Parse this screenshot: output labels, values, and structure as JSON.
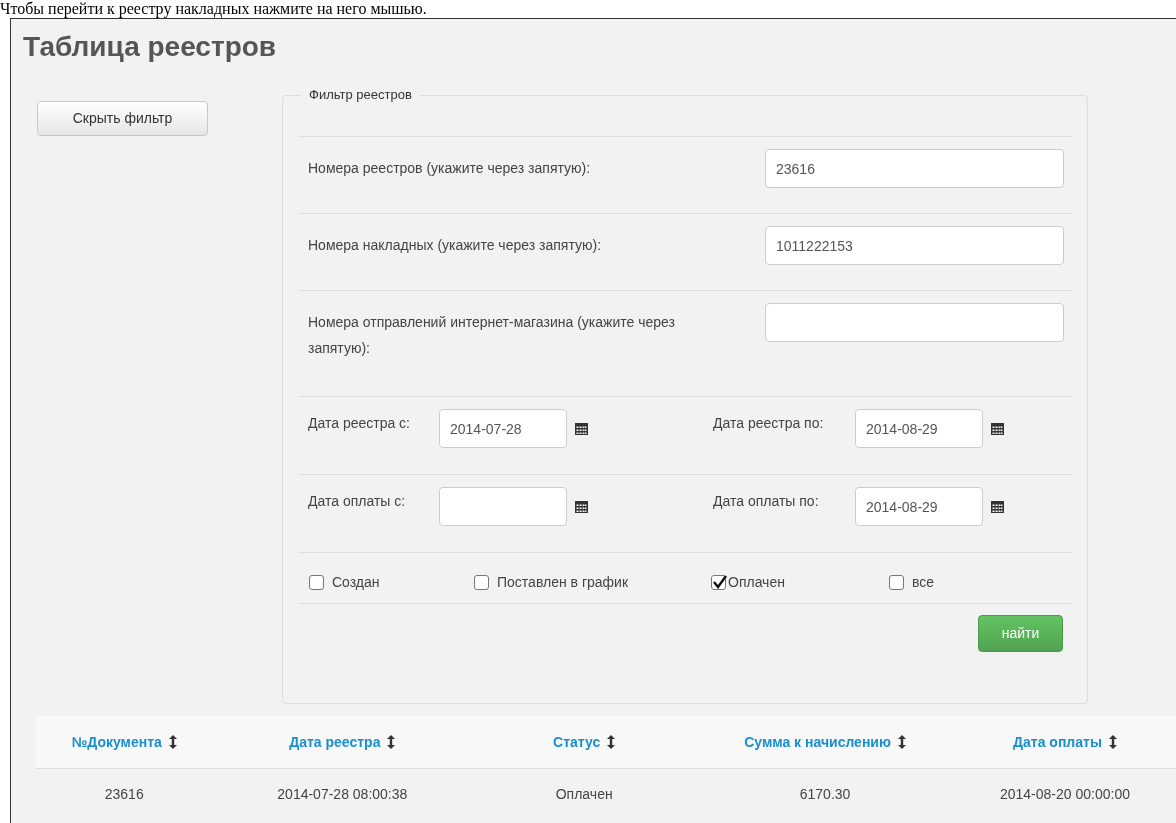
{
  "instruction": "Чтобы перейти к реестру накладных нажмите на него мышью.",
  "title": "Таблица реестров",
  "toggle_filter_button": "Скрыть фильтр",
  "filter": {
    "legend": "Фильтр реестров",
    "text_fields": [
      {
        "label": "Номера реестров (укажите через запятую):",
        "value": "23616"
      },
      {
        "label": "Номера накладных (укажите через запятую):",
        "value": "1011222153"
      },
      {
        "label": "Номера отправлений интернет-магазина (укажите через запятую):"
      }
    ],
    "date_rows": [
      [
        {
          "label": "Дата реестра с:",
          "value": "2014-07-28"
        },
        {
          "label": "Дата реестра по:",
          "value": "2014-08-29"
        }
      ],
      [
        {
          "label": "Дата оплаты с:"
        },
        {
          "label": "Дата оплаты по:",
          "value": "2014-08-29"
        }
      ]
    ],
    "checkboxes": [
      {
        "label": "Создан",
        "checked": false
      },
      {
        "label": "Поставлен в график",
        "checked": false
      },
      {
        "label": "Оплачен",
        "checked": true
      },
      {
        "label": "все",
        "checked": false
      }
    ],
    "search_button": "найти"
  },
  "table": {
    "columns": [
      "№Документа",
      "Дата реестра",
      "Статус",
      "Сумма к начислению",
      "Дата оплаты"
    ],
    "rows": [
      [
        "23616",
        "2014-07-28 08:00:38",
        "Оплачен",
        "6170.30",
        "2014-08-20 00:00:00"
      ]
    ]
  }
}
